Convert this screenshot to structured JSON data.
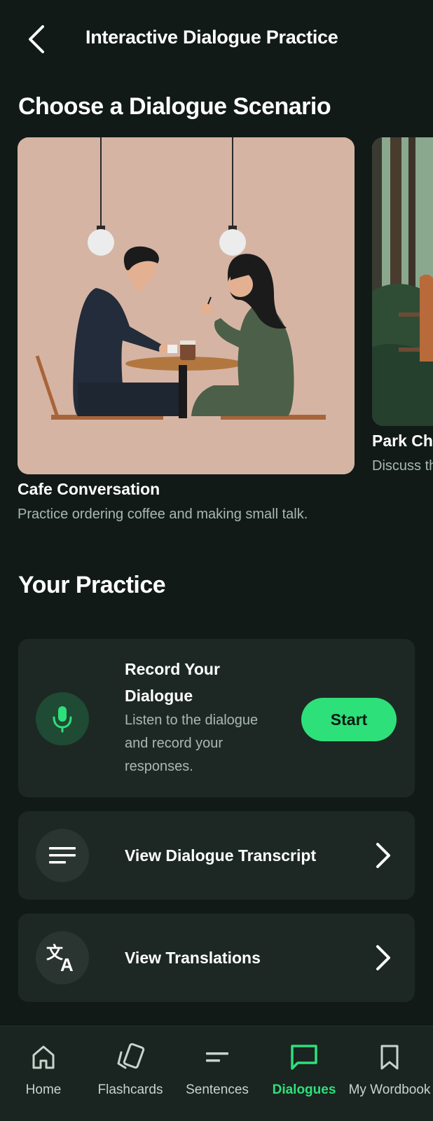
{
  "header": {
    "title": "Interactive Dialogue Practice",
    "back_icon": "chevron-left-icon"
  },
  "scenarios": {
    "section_title": "Choose a Dialogue Scenario",
    "items": [
      {
        "title": "Cafe Conversation",
        "description": "Practice ordering coffee and making small talk."
      },
      {
        "title": "Park Chat",
        "description": "Discuss the"
      }
    ]
  },
  "practice": {
    "section_title": "Your Practice",
    "record": {
      "title_line1": "Record Your",
      "title_line2": "Dialogue",
      "desc_line1": "Listen to the dialogue",
      "desc_line2": "and record your",
      "desc_line3": "responses.",
      "button_label": "Start",
      "icon": "microphone-icon"
    },
    "transcript": {
      "label": "View Dialogue Transcript",
      "icon": "lines-icon"
    },
    "translations": {
      "label": "View Translations",
      "icon": "translate-icon"
    }
  },
  "nav": {
    "items": [
      {
        "label": "Home",
        "icon": "home-icon"
      },
      {
        "label": "Flashcards",
        "icon": "flashcards-icon"
      },
      {
        "label": "Sentences",
        "icon": "sentences-icon"
      },
      {
        "label": "Dialogues",
        "icon": "chat-icon",
        "active": true
      },
      {
        "label": "My Wordbook",
        "icon": "bookmark-icon"
      }
    ]
  },
  "colors": {
    "background": "#111a17",
    "card": "#1d2824",
    "accent": "#2ee07a",
    "muted_text": "#a9b8b1"
  }
}
